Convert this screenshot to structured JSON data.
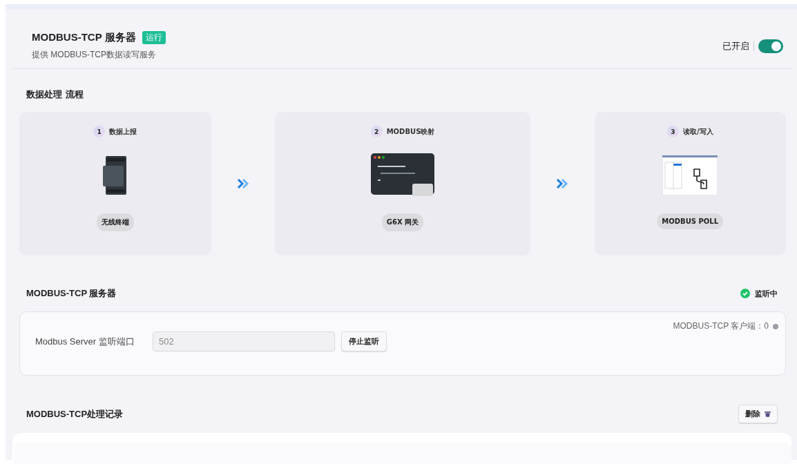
{
  "header": {
    "title": "MODBUS-TCP 服务器",
    "badge": "运行",
    "subtitle": "提供 MODBUS-TCP数据读写服务",
    "switch_label": "已开启",
    "switch_on": true
  },
  "flow": {
    "title": "数据处理 流程",
    "steps": [
      {
        "number": "1",
        "title": "数据上报",
        "kind": "device",
        "label": "无线终端"
      },
      {
        "number": "2",
        "title": "MODBUS映射",
        "kind": "editor",
        "label": "G6X 网关"
      },
      {
        "number": "3",
        "title": "读取/写入",
        "kind": "software",
        "label": "MODBUS POLL"
      }
    ]
  },
  "server": {
    "title": "MODBUS-TCP 服务器",
    "status": "监听中",
    "port_label": "Modbus Server 监听端口",
    "port_value": "502",
    "port_disabled": true,
    "button": "停止监听",
    "clients": "MODBUS-TCP 客户端：0"
  },
  "records": {
    "title": "MODBUS-TCP处理记录",
    "delete_button": "删除"
  }
}
